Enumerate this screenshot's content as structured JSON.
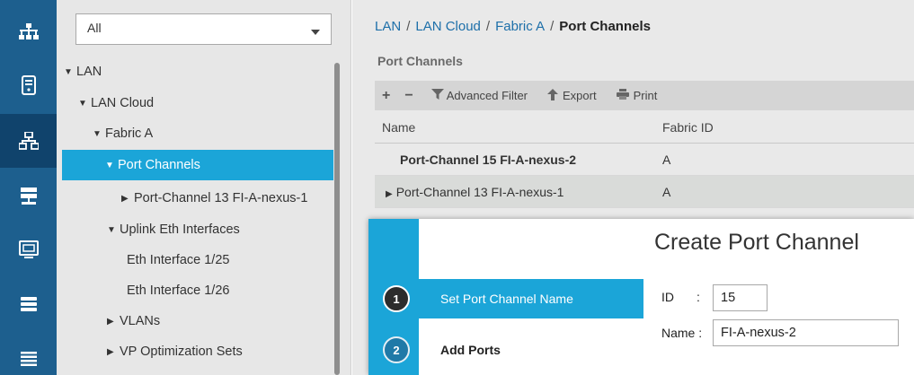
{
  "rail": {
    "items": [
      {
        "icon": "network-topology-icon"
      },
      {
        "icon": "server-icon"
      },
      {
        "icon": "lan-icon"
      },
      {
        "icon": "san-storage-icon"
      },
      {
        "icon": "vm-monitor-icon"
      },
      {
        "icon": "storage-stack-icon"
      },
      {
        "icon": "list-icon"
      }
    ]
  },
  "nav": {
    "filter_value": "All",
    "tree": [
      {
        "label": "LAN",
        "toggle": "▼"
      },
      {
        "label": "LAN Cloud",
        "toggle": "▼"
      },
      {
        "label": "Fabric A",
        "toggle": "▼"
      },
      {
        "label": "Port Channels",
        "toggle": "▼"
      },
      {
        "label": "Port-Channel 13 FI-A-nexus-1",
        "toggle": "▶"
      },
      {
        "label": "Uplink Eth Interfaces",
        "toggle": "▼"
      },
      {
        "label": "Eth Interface 1/25",
        "toggle": ""
      },
      {
        "label": "Eth Interface 1/26",
        "toggle": ""
      },
      {
        "label": "VLANs",
        "toggle": "▶"
      },
      {
        "label": "VP Optimization Sets",
        "toggle": "▶"
      }
    ]
  },
  "breadcrumb": {
    "items": [
      "LAN",
      "LAN Cloud",
      "Fabric A"
    ],
    "separator": "/",
    "current": "Port Channels"
  },
  "section_title": "Port Channels",
  "toolbar": {
    "add": "+",
    "remove": "−",
    "advanced_filter": "Advanced Filter",
    "export": "Export",
    "print": "Print"
  },
  "table": {
    "columns": [
      "Name",
      "Fabric ID"
    ],
    "rows": [
      {
        "name": "Port-Channel 15 FI-A-nexus-2",
        "fabric_id": "A"
      },
      {
        "name": "Port-Channel 13 FI-A-nexus-1",
        "fabric_id": "A"
      }
    ]
  },
  "wizard": {
    "title": "Create Port Channel",
    "steps": [
      {
        "number": "1",
        "label": "Set Port Channel Name"
      },
      {
        "number": "2",
        "label": "Add Ports"
      }
    ],
    "id_label": "ID",
    "colon": ":",
    "id_value": "15",
    "name_label": "Name :",
    "name_value": "FI-A-nexus-2"
  },
  "colors": {
    "rail": "#1d5f8e",
    "selection": "#1ba5d8",
    "link": "#1d6fa9"
  }
}
